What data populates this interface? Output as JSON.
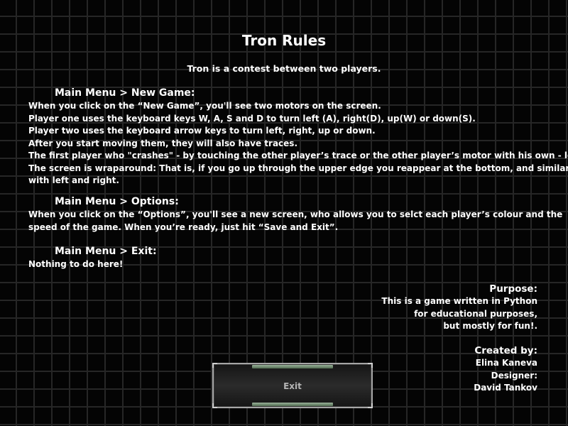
{
  "title": "Tron Rules",
  "subtitle": "Tron is a contest between two players.",
  "sections": [
    {
      "heading": "Main Menu > New Game:",
      "lines": [
        " When you click on the “New Game”, you'll see two motors on the screen.",
        "Player one uses the keyboard keys W, A, S and D to turn left (A), right(D), up(W) or down(S).",
        "Player two uses the keyboard arrow keys to turn left, right, up or down.",
        "After you start moving them, they will also have traces.",
        " The first player who \"crashes\" - by touching the other player’s trace or the other player’s motor with his own - loses.",
        " The screen is wraparound: That is, if you go up through the upper edge you reappear at the bottom, and similarly",
        "with left and right."
      ]
    },
    {
      "heading": "Main Menu > Options:",
      "lines": [
        " When you click on the “Options”, you'll see a new screen, who allows you to selct each player’s colour and the",
        "speed of the game.  When you’re ready, just hit “Save and Exit”."
      ]
    },
    {
      "heading": "Main Menu > Exit:",
      "lines": [
        "Nothing to do here!"
      ]
    }
  ],
  "purpose": {
    "heading": "Purpose:",
    "lines": [
      "This is a game written in Python",
      "for educational purposes,",
      "but mostly for fun!."
    ]
  },
  "credits": {
    "heading": "Created by:",
    "lines": [
      "Elina Kaneva",
      "Designer:",
      "David Tankov"
    ]
  },
  "exit_button": {
    "label": "Exit"
  }
}
